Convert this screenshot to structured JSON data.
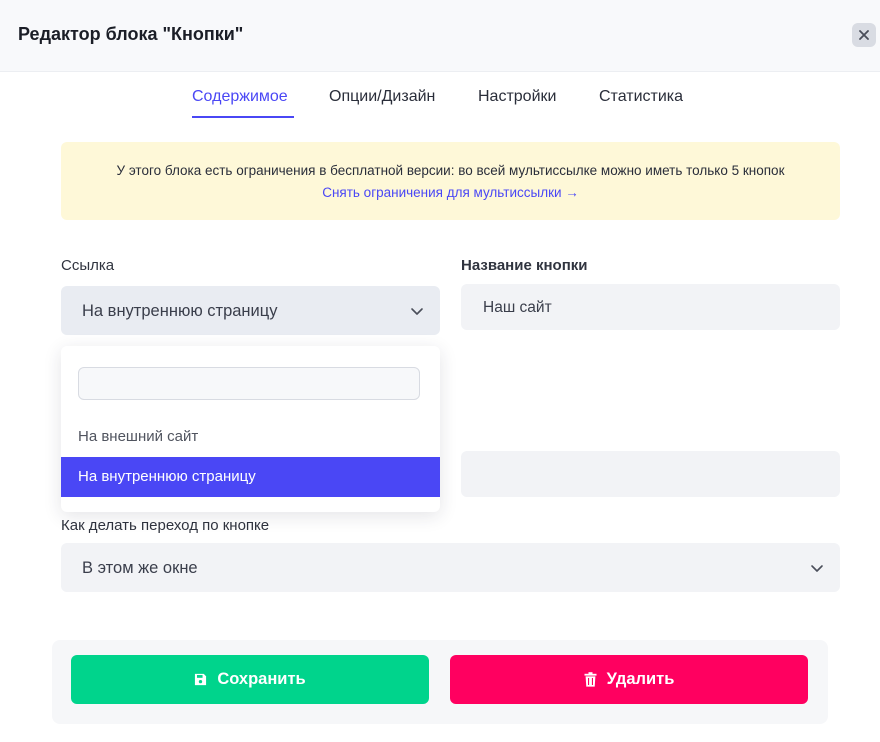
{
  "modal": {
    "title": "Редактор блока \"Кнопки\""
  },
  "tabs": [
    {
      "label": "Содержимое",
      "active": true
    },
    {
      "label": "Опции/Дизайн",
      "active": false
    },
    {
      "label": "Настройки",
      "active": false
    },
    {
      "label": "Статистика",
      "active": false
    }
  ],
  "notice": {
    "text": "У этого блока есть ограничения в бесплатной версии: во всей мультиссылке можно иметь только 5 кнопок",
    "link": "Снять ограничения для мультиссылки →"
  },
  "link_field": {
    "label": "Ссылка",
    "value": "На внутреннюю страницу",
    "dropdown": {
      "search_value": "",
      "options": [
        {
          "label": "На внешний сайт",
          "selected": false
        },
        {
          "label": "На внутреннюю страницу",
          "selected": true
        }
      ]
    }
  },
  "name_field": {
    "label": "Название кнопки",
    "value": "Наш сайт"
  },
  "transition_field": {
    "label": "Как делать переход по кнопке",
    "value": "В этом же окне"
  },
  "buttons": {
    "save": "Сохранить",
    "delete": "Удалить"
  },
  "colors": {
    "accent": "#4a47f5",
    "save": "#00d48c",
    "delete": "#ff0060",
    "notice_bg": "#fef8d8"
  },
  "icons": [
    "close-icon",
    "chevron-down-icon",
    "save-disk-icon",
    "trash-icon"
  ]
}
